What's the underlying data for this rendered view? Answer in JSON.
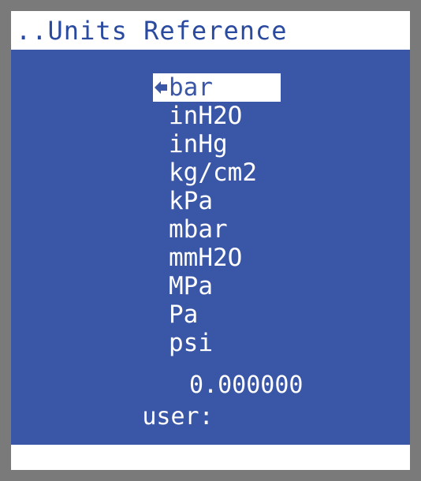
{
  "title": "..Units Reference",
  "units": [
    {
      "label": "bar",
      "selected": true
    },
    {
      "label": "inH2O",
      "selected": false
    },
    {
      "label": "inHg",
      "selected": false
    },
    {
      "label": "kg/cm2",
      "selected": false
    },
    {
      "label": "kPa",
      "selected": false
    },
    {
      "label": "mbar",
      "selected": false
    },
    {
      "label": "mmH2O",
      "selected": false
    },
    {
      "label": "MPa",
      "selected": false
    },
    {
      "label": "Pa",
      "selected": false
    },
    {
      "label": "psi",
      "selected": false
    }
  ],
  "user": {
    "label": "user:",
    "value": "0.000000"
  },
  "colors": {
    "background": "#3a56a6",
    "frame": "#7a7a7a",
    "text": "#ffffff"
  },
  "icons": {
    "cursor": "right-arrow-cursor-icon"
  }
}
